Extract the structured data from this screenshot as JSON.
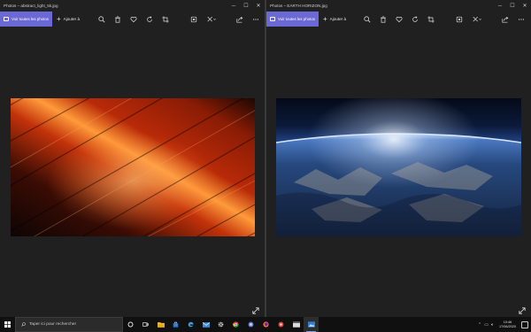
{
  "left_window": {
    "title": "Photos – abstract_light_5k.jpg",
    "see_all_label": "Voir toutes les photos",
    "add_to_label": "Ajouter à"
  },
  "right_window": {
    "title": "Photos – EARTH HORIZON.jpg",
    "see_all_label": "Voir toutes les photos",
    "add_to_label": "Ajouter à"
  },
  "toolbar_icons": [
    "zoom-icon",
    "delete-icon",
    "favorite-icon",
    "rotate-icon",
    "crop-icon",
    "edit-icon",
    "draw-icon",
    "share-icon",
    "more-icon"
  ],
  "taskbar": {
    "search_placeholder": "Taper ici pour rechercher",
    "time": "10:46",
    "date": "17/06/2020"
  },
  "colors": {
    "accent": "#6b69d6",
    "window_bg": "#202020",
    "taskbar_bg": "#101010"
  }
}
